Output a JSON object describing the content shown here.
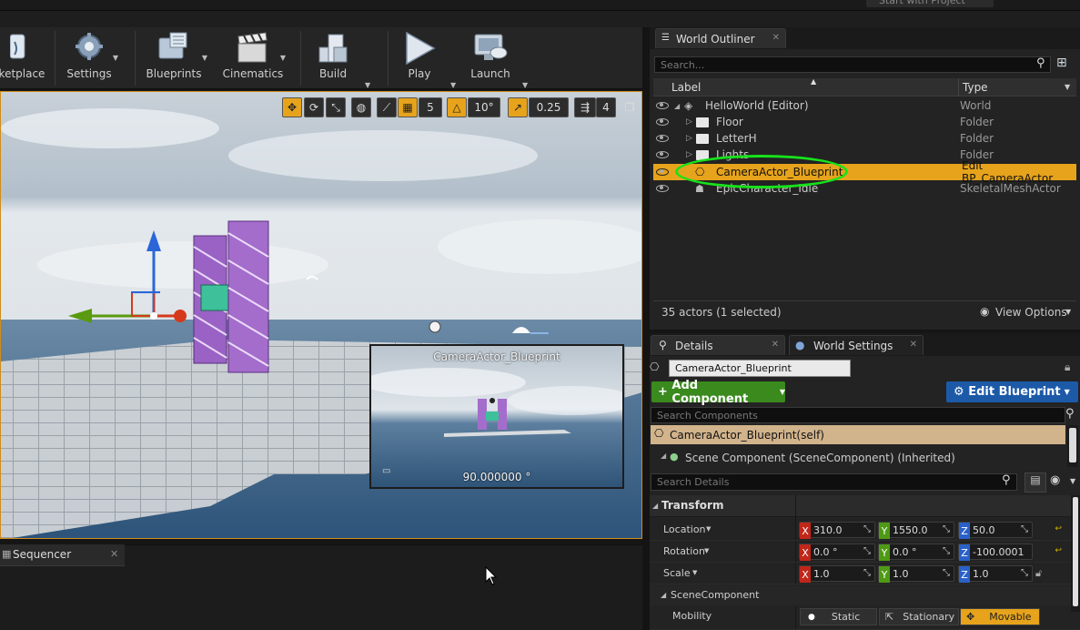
{
  "topbar": {
    "project_button": "Start with Project"
  },
  "toolbar": {
    "marketplace": "ketplace",
    "settings": "Settings",
    "blueprints": "Blueprints",
    "cinematics": "Cinematics",
    "build": "Build",
    "play": "Play",
    "launch": "Launch"
  },
  "viewport": {
    "grid_snap": "5",
    "rotation_snap": "10°",
    "scale_snap": "0.25",
    "camera_speed": "4",
    "preview_title": "CameraActor_Blueprint",
    "preview_fov": "90.000000 °"
  },
  "sequencer": {
    "tab": "Sequencer"
  },
  "outliner": {
    "tab": "World Outliner",
    "search_placeholder": "Search...",
    "col_label": "Label",
    "col_type": "Type",
    "rows": [
      {
        "label": "HelloWorld (Editor)",
        "type": "World"
      },
      {
        "label": "Floor",
        "type": "Folder"
      },
      {
        "label": "LetterH",
        "type": "Folder"
      },
      {
        "label": "Lights",
        "type": "Folder"
      },
      {
        "label": "CameraActor_Blueprint",
        "type": "Edit BP_CameraActor"
      },
      {
        "label": "EpicCharacter_Idle",
        "type": "SkeletalMeshActor"
      }
    ],
    "status": "35 actors (1 selected)",
    "view_options": "View Options"
  },
  "details": {
    "tab": "Details",
    "tab2": "World Settings",
    "name_value": "CameraActor_Blueprint",
    "add_component": "Add Component",
    "edit_blueprint": "Edit Blueprint",
    "search_components_placeholder": "Search Components",
    "self_item": "CameraActor_Blueprint(self)",
    "scene_item": "Scene Component (SceneComponent) (Inherited)",
    "search_details_placeholder": "Search Details",
    "transform": "Transform",
    "location": "Location",
    "rotation": "Rotation",
    "scale": "Scale",
    "loc": [
      "310.0",
      "1550.0",
      "50.0"
    ],
    "rot": [
      "0.0 °",
      "0.0 °",
      "-100.0001"
    ],
    "scl": [
      "1.0",
      "1.0",
      "1.0"
    ],
    "axis": [
      "X",
      "Y",
      "Z"
    ],
    "scene_component": "SceneComponent",
    "mobility": "Mobility",
    "mob_static": "Static",
    "mob_stationary": "Stationary",
    "mob_movable": "Movable"
  },
  "colors": {
    "accent_orange": "#e6a31b",
    "blueprint_blue": "#1c5aa8",
    "add_green": "#3a8a1e",
    "annotation_green": "#17e21a"
  }
}
